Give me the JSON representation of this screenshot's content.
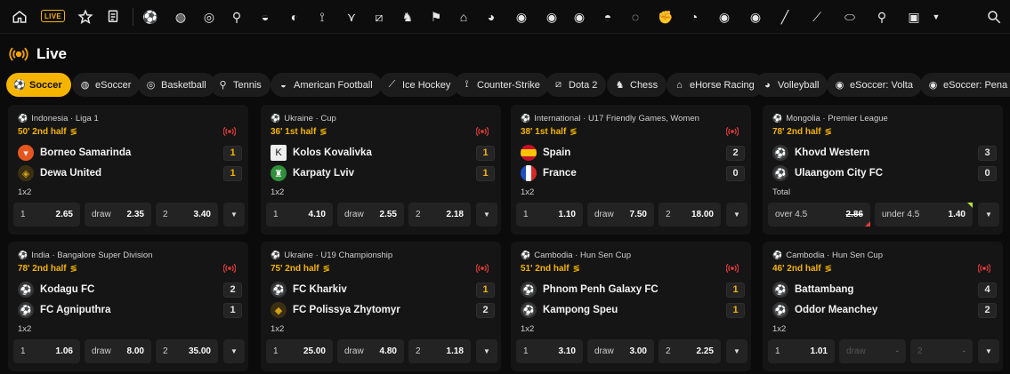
{
  "nav": {
    "live_label": "LIVE",
    "icons": [
      "home-icon",
      "live-badge",
      "star-icon",
      "betslip-icon",
      "soccer-icon",
      "esoccer-icon",
      "basketball-icon",
      "tennis-icon",
      "american-football-icon",
      "counter-strike-icon",
      "valorant-icon",
      "dota2-icon",
      "chess-icon",
      "racing-flag-icon",
      "ehorse-racing-icon",
      "volleyball-icon",
      "esoccer-volta-icon",
      "esoccer-penalty-icon",
      "ebasketball-icon",
      "table-tennis-icon",
      "ehockey-icon",
      "cricket-icon",
      "efighting-icon",
      "efootball-icon",
      "hockey-stick-icon",
      "baseball-icon",
      "rugby-icon",
      "badminton-icon",
      "more-sports-icon",
      "search-icon"
    ]
  },
  "heading": {
    "title": "Live"
  },
  "tabs": [
    {
      "label": "Soccer",
      "icon": "soccer-icon",
      "active": true
    },
    {
      "label": "eSoccer",
      "icon": "esoccer-icon"
    },
    {
      "label": "Basketball",
      "icon": "basketball-icon"
    },
    {
      "label": "Tennis",
      "icon": "tennis-icon"
    },
    {
      "label": "American Football",
      "icon": "american-football-icon"
    },
    {
      "label": "Ice Hockey",
      "icon": "ice-hockey-icon"
    },
    {
      "label": "Counter-Strike",
      "icon": "counter-strike-icon"
    },
    {
      "label": "Dota 2",
      "icon": "dota2-icon"
    },
    {
      "label": "Chess",
      "icon": "chess-icon"
    },
    {
      "label": "eHorse Racing",
      "icon": "ehorse-racing-icon"
    },
    {
      "label": "Volleyball",
      "icon": "volleyball-icon"
    },
    {
      "label": "eSoccer: Volta",
      "icon": "esoccer-volta-icon"
    },
    {
      "label": "eSoccer: Pena",
      "icon": "esoccer-penalty-icon"
    }
  ],
  "matches": [
    {
      "league": "Indonesia · Liga 1",
      "time": "50' 2nd half",
      "home": {
        "name": "Borneo Samarinda",
        "score": "1",
        "logo_color": "#e5561e"
      },
      "away": {
        "name": "Dewa United",
        "score": "1",
        "logo_color": "#b8860b"
      },
      "market": "1x2",
      "odds": [
        {
          "label": "1",
          "value": "2.65"
        },
        {
          "label": "draw",
          "value": "2.35"
        },
        {
          "label": "2",
          "value": "3.40"
        }
      ]
    },
    {
      "league": "Ukraine · Cup",
      "time": "36' 1st half",
      "home": {
        "name": "Kolos Kovalivka",
        "score": "1",
        "logo_color": "#dddddd"
      },
      "away": {
        "name": "Karpaty Lviv",
        "score": "1",
        "logo_color": "#2f8f3a"
      },
      "market": "1x2",
      "odds": [
        {
          "label": "1",
          "value": "4.10"
        },
        {
          "label": "draw",
          "value": "2.55"
        },
        {
          "label": "2",
          "value": "2.18"
        }
      ]
    },
    {
      "league": "International · U17 Friendly Games, Women",
      "time": "38' 1st half",
      "home": {
        "name": "Spain",
        "score": "2",
        "logo_color": "#d62828"
      },
      "away": {
        "name": "France",
        "score": "0",
        "logo_color": "#1f4fbf"
      },
      "market": "1x2",
      "odds": [
        {
          "label": "1",
          "value": "1.10"
        },
        {
          "label": "draw",
          "value": "7.50"
        },
        {
          "label": "2",
          "value": "18.00"
        }
      ]
    },
    {
      "league": "Mongolia · Premier League",
      "time": "78' 2nd half",
      "home": {
        "name": "Khovd Western",
        "score": "3",
        "logo_color": "#444444"
      },
      "away": {
        "name": "Ulaangom City FC",
        "score": "0",
        "logo_color": "#444444"
      },
      "market": "Total",
      "odds": [
        {
          "label": "over 4.5",
          "value": "2.86"
        },
        {
          "label": "under 4.5",
          "value": "1.40"
        }
      ]
    },
    {
      "league": "India · Bangalore Super Division",
      "time": "78' 2nd half",
      "home": {
        "name": "Kodagu FC",
        "score": "2",
        "logo_color": "#444444"
      },
      "away": {
        "name": "FC Agniputhra",
        "score": "1",
        "logo_color": "#444444"
      },
      "market": "1x2",
      "odds": [
        {
          "label": "1",
          "value": "1.06"
        },
        {
          "label": "draw",
          "value": "8.00"
        },
        {
          "label": "2",
          "value": "35.00"
        }
      ]
    },
    {
      "league": "Ukraine · U19 Championship",
      "time": "75' 2nd half",
      "home": {
        "name": "FC Kharkiv",
        "score": "1",
        "logo_color": "#444444"
      },
      "away": {
        "name": "FC Polissya Zhytomyr",
        "score": "2",
        "logo_color": "#c9a227"
      },
      "market": "1x2",
      "odds": [
        {
          "label": "1",
          "value": "25.00"
        },
        {
          "label": "draw",
          "value": "4.80"
        },
        {
          "label": "2",
          "value": "1.18"
        }
      ]
    },
    {
      "league": "Cambodia · Hun Sen Cup",
      "time": "51' 2nd half",
      "home": {
        "name": "Phnom Penh Galaxy FC",
        "score": "1",
        "logo_color": "#444444"
      },
      "away": {
        "name": "Kampong Speu",
        "score": "1",
        "logo_color": "#444444"
      },
      "market": "1x2",
      "odds": [
        {
          "label": "1",
          "value": "3.10"
        },
        {
          "label": "draw",
          "value": "3.00"
        },
        {
          "label": "2",
          "value": "2.25"
        }
      ]
    },
    {
      "league": "Cambodia · Hun Sen Cup",
      "time": "46' 2nd half",
      "home": {
        "name": "Battambang",
        "score": "4",
        "logo_color": "#444444"
      },
      "away": {
        "name": "Oddor Meanchey",
        "score": "2",
        "logo_color": "#444444"
      },
      "market": "1x2",
      "odds": [
        {
          "label": "1",
          "value": "1.01"
        },
        {
          "label": "draw",
          "value": "-"
        },
        {
          "label": "2",
          "value": "-"
        }
      ]
    }
  ],
  "colors": {
    "accent": "#f4b400",
    "live_red": "#e23a3a",
    "odds_up": "#b7e03b",
    "card_bg": "#151515",
    "odds_bg": "#232323"
  }
}
